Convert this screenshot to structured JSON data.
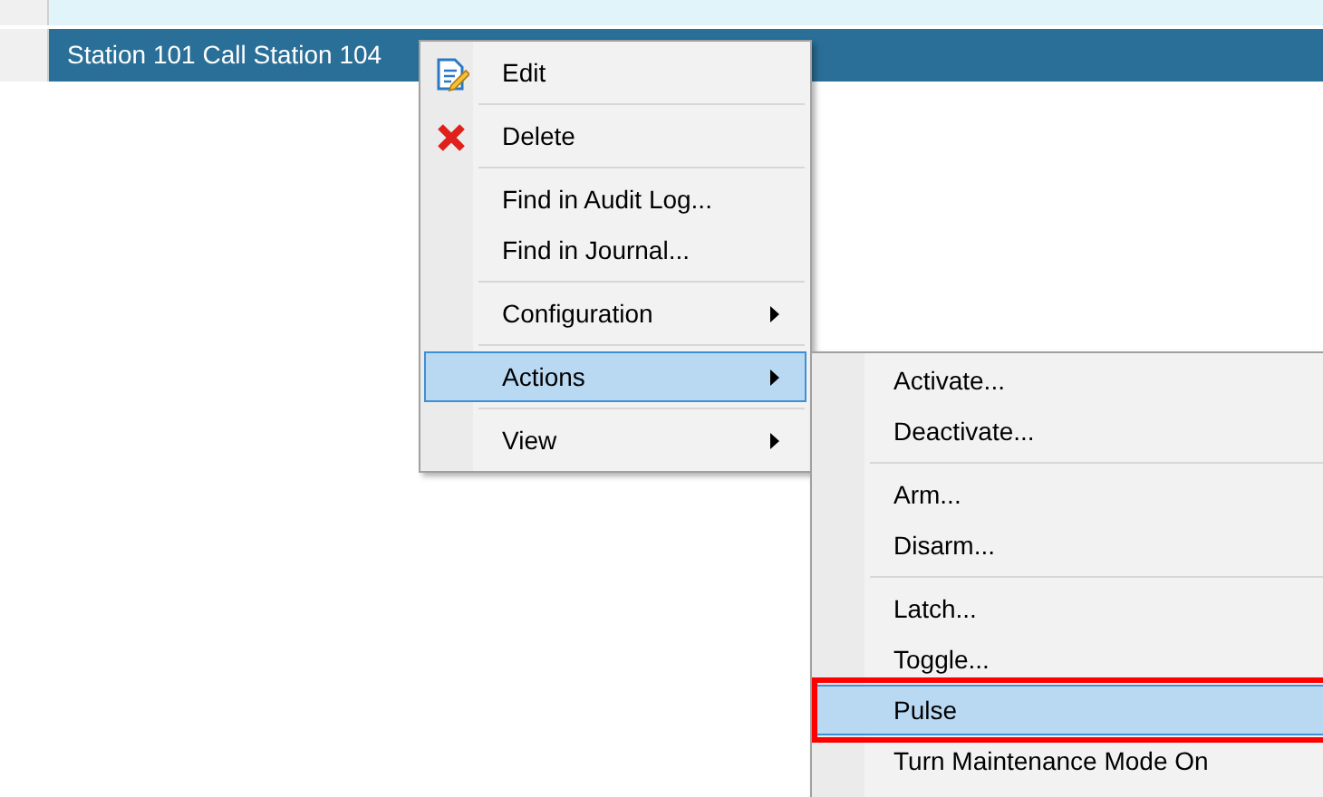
{
  "list": {
    "rows": [
      {
        "text": "",
        "selected": false
      },
      {
        "text": "Station 101 Call Station 104",
        "selected": true
      }
    ]
  },
  "context_menu": {
    "items": [
      {
        "kind": "edit",
        "label": "Edit",
        "selected": false
      },
      {
        "kind": "separator"
      },
      {
        "kind": "delete",
        "label": "Delete",
        "selected": false
      },
      {
        "kind": "separator"
      },
      {
        "kind": "item",
        "label": "Find in Audit Log...",
        "selected": false
      },
      {
        "kind": "item",
        "label": "Find in Journal...",
        "selected": false
      },
      {
        "kind": "separator"
      },
      {
        "kind": "submenu",
        "label": "Configuration",
        "selected": false
      },
      {
        "kind": "separator"
      },
      {
        "kind": "submenu",
        "label": "Actions",
        "selected": true
      },
      {
        "kind": "separator"
      },
      {
        "kind": "submenu",
        "label": "View",
        "selected": false
      }
    ]
  },
  "actions_submenu": {
    "items": [
      {
        "kind": "item",
        "label": "Activate...",
        "selected": false,
        "outlined": false
      },
      {
        "kind": "item",
        "label": "Deactivate...",
        "selected": false,
        "outlined": false
      },
      {
        "kind": "separator"
      },
      {
        "kind": "item",
        "label": "Arm...",
        "selected": false,
        "outlined": false
      },
      {
        "kind": "item",
        "label": "Disarm...",
        "selected": false,
        "outlined": false
      },
      {
        "kind": "separator"
      },
      {
        "kind": "item",
        "label": "Latch...",
        "selected": false,
        "outlined": false
      },
      {
        "kind": "item",
        "label": "Toggle...",
        "selected": false,
        "outlined": false
      },
      {
        "kind": "item",
        "label": "Pulse",
        "selected": true,
        "outlined": true
      },
      {
        "kind": "item",
        "label": "Turn Maintenance Mode On",
        "selected": false,
        "outlined": false
      }
    ]
  }
}
